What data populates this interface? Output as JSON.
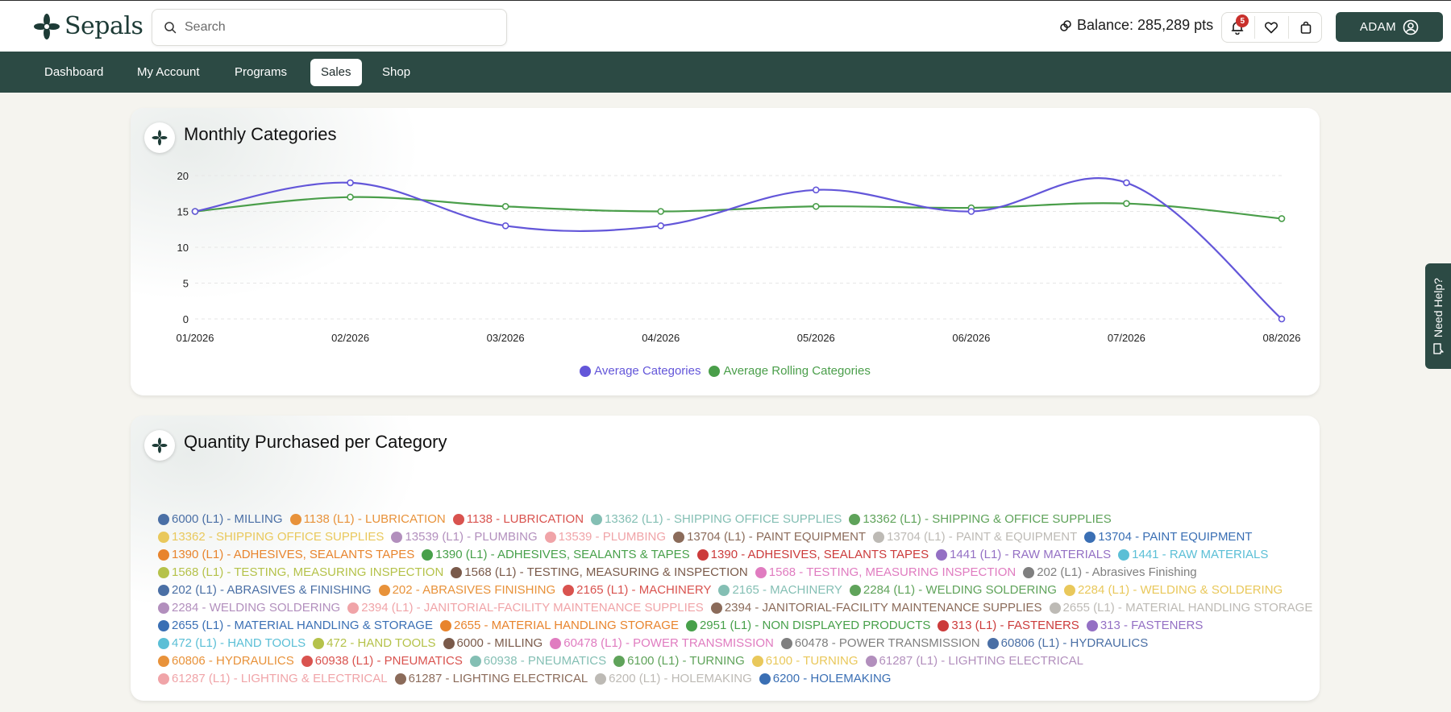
{
  "app": {
    "logo_text": "Sepals"
  },
  "search": {
    "placeholder": "Search"
  },
  "header": {
    "balance": "Balance: 285,289 pts",
    "notification_count": "5",
    "user_label": "ADAM"
  },
  "nav": {
    "items": [
      {
        "label": "Dashboard"
      },
      {
        "label": "My Account"
      },
      {
        "label": "Programs"
      },
      {
        "label": "Sales",
        "active": true
      },
      {
        "label": "Shop"
      }
    ]
  },
  "help": {
    "label": "Need Help?"
  },
  "colors": {
    "brand": "#2c4a44",
    "series_avg": "#6356d9",
    "series_rolling": "#4a9e4a",
    "badge": "#c9302c"
  },
  "monthly": {
    "title": "Monthly Categories",
    "chart_data": {
      "type": "line",
      "title": "Monthly Categories",
      "x": [
        "01/2026",
        "02/2026",
        "03/2026",
        "04/2026",
        "05/2026",
        "06/2026",
        "07/2026",
        "08/2026"
      ],
      "ylim": [
        0,
        20
      ],
      "yticks": [
        0,
        5,
        10,
        15,
        20
      ],
      "grid": true,
      "legend": "bottom-center",
      "series": [
        {
          "name": "Average Categories",
          "color": "#6356d9",
          "values": [
            15,
            19,
            13,
            13,
            18,
            15,
            19,
            0
          ]
        },
        {
          "name": "Average Rolling Categories",
          "color": "#4a9e4a",
          "values": [
            15,
            17,
            15.7,
            15,
            15.7,
            15.5,
            16.1,
            14
          ]
        }
      ]
    }
  },
  "quantity": {
    "title": "Quantity Purchased per Category",
    "legend_rows": [
      [
        {
          "label": "6000 (L1) - MILLING",
          "color": "#4a6fa5"
        },
        {
          "label": "1138 (L1) - LUBRICATION",
          "color": "#e8923a"
        },
        {
          "label": "1138 - LUBRICATION",
          "color": "#d9534f"
        },
        {
          "label": "13362 (L1) - SHIPPING OFFICE SUPPLIES",
          "color": "#84bfb4"
        },
        {
          "label": "13362 (L1) - SHIPPING & OFFICE SUPPLIES",
          "color": "#5fa35a"
        }
      ],
      [
        {
          "label": "13362 - SHIPPING OFFICE SUPPLIES",
          "color": "#e9c85b"
        },
        {
          "label": "13539 (L1) - PLUMBING",
          "color": "#b28fbd"
        },
        {
          "label": "13539 - PLUMBING",
          "color": "#f0a4a8"
        },
        {
          "label": "13704 (L1) - PAINT EQUIPMENT",
          "color": "#8b6b5a"
        },
        {
          "label": "13704 (L1) - PAINT & EQUIPMENT",
          "color": "#bdbab5"
        },
        {
          "label": "13704 - PAINT EQUIPMENT",
          "color": "#3a6fb4"
        }
      ],
      [
        {
          "label": "1390 (L1) - ADHESIVES, SEALANTS TAPES",
          "color": "#e8842d"
        },
        {
          "label": "1390 (L1) - ADHESIVES, SEALANTS & TAPES",
          "color": "#47a04a"
        },
        {
          "label": "1390 - ADHESIVES, SEALANTS TAPES",
          "color": "#cc3b3b"
        },
        {
          "label": "1441 (L1) - RAW MATERIALS",
          "color": "#9470c4"
        },
        {
          "label": "1441 - RAW MATERIALS",
          "color": "#5bbfd6"
        }
      ],
      [
        {
          "label": "1568 (L1) - TESTING, MEASURING INSPECTION",
          "color": "#b5c24a"
        },
        {
          "label": "1568 (L1) - TESTING, MEASURING & INSPECTION",
          "color": "#7a5a4a"
        },
        {
          "label": "1568 - TESTING, MEASURING INSPECTION",
          "color": "#e07cc0"
        },
        {
          "label": "202 (L1) - Abrasives Finishing",
          "color": "#7f7f7f"
        }
      ],
      [
        {
          "label": "202 (L1) - ABRASIVES & FINISHING",
          "color": "#4a6fa5"
        },
        {
          "label": "202 - ABRASIVES FINISHING",
          "color": "#e8923a"
        },
        {
          "label": "2165 (L1) - MACHINERY",
          "color": "#d9534f"
        },
        {
          "label": "2165 - MACHINERY",
          "color": "#84bfb4"
        },
        {
          "label": "2284 (L1) - WELDING SOLDERING",
          "color": "#5fa35a"
        },
        {
          "label": "2284 (L1) - WELDING & SOLDERING",
          "color": "#e9c85b"
        }
      ],
      [
        {
          "label": "2284 - WELDING SOLDERING",
          "color": "#b28fbd"
        },
        {
          "label": "2394 (L1) - JANITORIAL-FACILITY MAINTENANCE SUPPLIES",
          "color": "#f0a4a8"
        },
        {
          "label": "2394 - JANITORIAL-FACILITY MAINTENANCE SUPPLIES",
          "color": "#8b6b5a"
        },
        {
          "label": "2655 (L1) - MATERIAL HANDLING STORAGE",
          "color": "#bdbab5"
        }
      ],
      [
        {
          "label": "2655 (L1) - MATERIAL HANDLING & STORAGE",
          "color": "#3a6fb4"
        },
        {
          "label": "2655 - MATERIAL HANDLING STORAGE",
          "color": "#e8842d"
        },
        {
          "label": "2951 (L1) - NON DISPLAYED PRODUCTS",
          "color": "#47a04a"
        },
        {
          "label": "313 (L1) - FASTENERS",
          "color": "#cc3b3b"
        },
        {
          "label": "313 - FASTENERS",
          "color": "#9470c4"
        }
      ],
      [
        {
          "label": "472 (L1) - HAND TOOLS",
          "color": "#5bbfd6"
        },
        {
          "label": "472 - HAND TOOLS",
          "color": "#b5c24a"
        },
        {
          "label": "6000 - MILLING",
          "color": "#7a5a4a"
        },
        {
          "label": "60478 (L1) - POWER TRANSMISSION",
          "color": "#e07cc0"
        },
        {
          "label": "60478 - POWER TRANSMISSION",
          "color": "#7f7f7f"
        },
        {
          "label": "60806 (L1) - HYDRAULICS",
          "color": "#4a6fa5"
        }
      ],
      [
        {
          "label": "60806 - HYDRAULICS",
          "color": "#e8923a"
        },
        {
          "label": "60938 (L1) - PNEUMATICS",
          "color": "#d9534f"
        },
        {
          "label": "60938 - PNEUMATICS",
          "color": "#84bfb4"
        },
        {
          "label": "6100 (L1) - TURNING",
          "color": "#5fa35a"
        },
        {
          "label": "6100 - TURNING",
          "color": "#e9c85b"
        },
        {
          "label": "61287 (L1) - LIGHTING ELECTRICAL",
          "color": "#b28fbd"
        }
      ],
      [
        {
          "label": "61287 (L1) - LIGHTING & ELECTRICAL",
          "color": "#f0a4a8"
        },
        {
          "label": "61287 - LIGHTING ELECTRICAL",
          "color": "#8b6b5a"
        },
        {
          "label": "6200 (L1) - HOLEMAKING",
          "color": "#bdbab5"
        },
        {
          "label": "6200 - HOLEMAKING",
          "color": "#3a6fb4"
        }
      ]
    ]
  }
}
